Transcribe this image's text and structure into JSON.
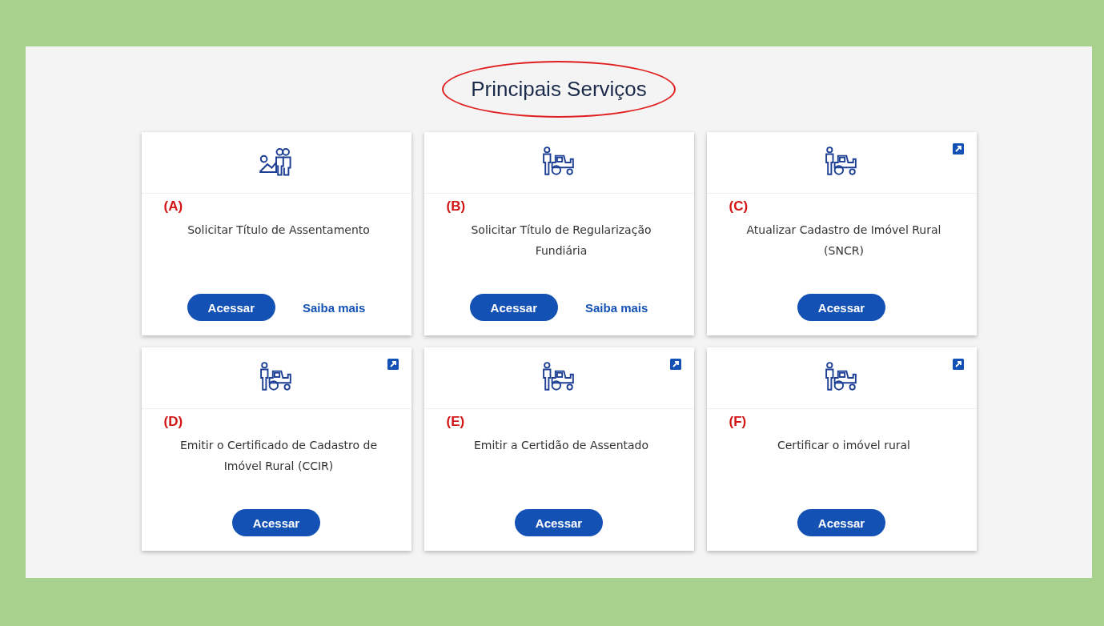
{
  "title": "Principais Serviços",
  "cards": [
    {
      "letter": "(A)",
      "title": "Solicitar Título de Assentamento",
      "kind": "settlement",
      "external": false,
      "links": [
        {
          "label": "Acessar",
          "kind": "primary"
        },
        {
          "label": "Saiba mais",
          "kind": "text"
        }
      ]
    },
    {
      "letter": "(B)",
      "title": "Solicitar Título de Regularização Fundiária",
      "kind": "tractor",
      "external": false,
      "links": [
        {
          "label": "Acessar",
          "kind": "primary"
        },
        {
          "label": "Saiba mais",
          "kind": "text"
        }
      ]
    },
    {
      "letter": "(C)",
      "title": "Atualizar Cadastro de Imóvel Rural (SNCR)",
      "kind": "tractor",
      "external": true,
      "links": [
        {
          "label": "Acessar",
          "kind": "primary"
        }
      ]
    },
    {
      "letter": "(D)",
      "title": "Emitir o Certificado de Cadastro de Imóvel Rural (CCIR)",
      "kind": "tractor",
      "external": true,
      "links": [
        {
          "label": "Acessar",
          "kind": "primary"
        }
      ]
    },
    {
      "letter": "(E)",
      "title": "Emitir a Certidão de Assentado",
      "kind": "tractor",
      "external": true,
      "links": [
        {
          "label": "Acessar",
          "kind": "primary"
        }
      ]
    },
    {
      "letter": "(F)",
      "title": "Certificar o imóvel rural",
      "kind": "tractor",
      "external": true,
      "links": [
        {
          "label": "Acessar",
          "kind": "primary"
        }
      ]
    }
  ]
}
